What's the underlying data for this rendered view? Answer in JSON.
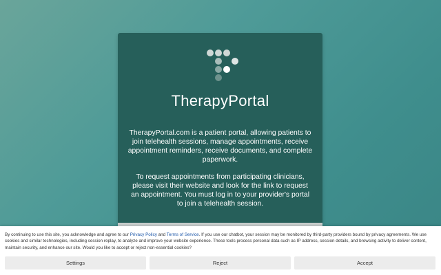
{
  "colors": {
    "card": "#265f5a",
    "background_from": "#6aa59a",
    "background_to": "#3a8585",
    "link": "#1a55a8",
    "button": "#ececec"
  },
  "logo": {
    "icon": "therapyportal-dots-logo",
    "dots": [
      {
        "color": "#cfd8d6"
      },
      {
        "color": "#cfd8d6"
      },
      {
        "color": "#cfd8d6"
      },
      {
        "color": "#a9bdba"
      },
      {
        "color": "#dde4e3"
      },
      {
        "color": "#8aa8a4"
      },
      {
        "color": "#ffffff"
      },
      {
        "color": "#6e928d"
      }
    ]
  },
  "card": {
    "brand": "TherapyPortal",
    "intro": "TherapyPortal.com is a patient portal, allowing patients to join telehealth sessions, manage appointments, receive appointment reminders, receive documents, and complete paperwork.",
    "request": "To request appointments from participating clinicians, please visit their website and look for the link to request an appointment. You must log in to your provider's portal to join a telehealth session."
  },
  "consent": {
    "text_before": "By continuing to use this site, you acknowledge and agree to our ",
    "privacy_link": "Privacy Policy",
    "and": " and ",
    "terms_link": "Terms of Service",
    "text_after": ". If you use our chatbot, your session may be monitored by third-party providers bound by privacy agreements. We use cookies and similar technologies, including session replay, to analyze and improve your website experience. These tools process personal data such as IP address, session details, and browsing activity to deliver content, maintain security, and enhance our site. Would you like to accept or reject non-essential cookies?",
    "buttons": {
      "settings": "Settings",
      "reject": "Reject",
      "accept": "Accept"
    }
  }
}
